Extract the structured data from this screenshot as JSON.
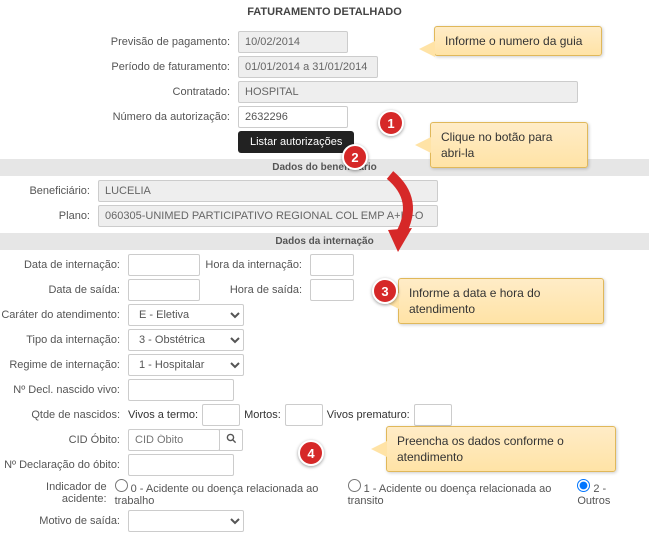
{
  "title": "FATURAMENTO DETALHADO",
  "top": {
    "previsao_lbl": "Previsão de pagamento:",
    "previsao_val": "10/02/2014",
    "periodo_lbl": "Período de faturamento:",
    "periodo_val": "01/01/2014 a 31/01/2014",
    "contratado_lbl": "Contratado:",
    "contratado_val": "HOSPITAL",
    "numauth_lbl": "Número da autorização:",
    "numauth_val": "2632296",
    "listar_btn": "Listar autorizações"
  },
  "section_benef": "Dados do beneficiário",
  "benef": {
    "benef_lbl": "Beneficiário:",
    "benef_val": "LUCELIA",
    "plano_lbl": "Plano:",
    "plano_val": "060305-UNIMED PARTICIPATIVO REGIONAL COL EMP A+H+O"
  },
  "section_intern": "Dados da internação",
  "intern": {
    "data_int_lbl": "Data de internação:",
    "hora_int_lbl": "Hora da internação:",
    "data_saida_lbl": "Data de saída:",
    "hora_saida_lbl": "Hora de saída:",
    "carater_lbl": "Caráter do atendimento:",
    "carater_val": "E - Eletiva",
    "tipo_lbl": "Tipo da internação:",
    "tipo_val": "3 - Obstétrica",
    "regime_lbl": "Regime de internação:",
    "regime_val": "1 - Hospitalar",
    "decl_nasc_lbl": "Nº Decl. nascido vivo:",
    "qtde_lbl": "Qtde de nascidos:",
    "vivos_lbl": "Vivos a termo:",
    "mortos_lbl": "Mortos:",
    "prematuro_lbl": "Vivos prematuro:",
    "cid_lbl": "CID Óbito:",
    "cid_ph": "CID Óbito",
    "decl_obito_lbl": "Nº Declaração do óbito:",
    "indicador_lbl": "Indicador de acidente:",
    "radio0": "0 - Acidente ou doença relacionada ao trabalho",
    "radio1": "1 - Acidente ou doença relacionada ao transito",
    "radio2": "2 - Outros",
    "motivo_lbl": "Motivo de saída:"
  },
  "callouts": {
    "c1": "Informe o numero da guia",
    "c2": "Clique no botão para abri-la",
    "c3": "Informe a data e hora do atendimento",
    "c4": "Preencha os dados conforme o atendimento"
  },
  "nums": {
    "n1": "1",
    "n2": "2",
    "n3": "3",
    "n4": "4"
  }
}
